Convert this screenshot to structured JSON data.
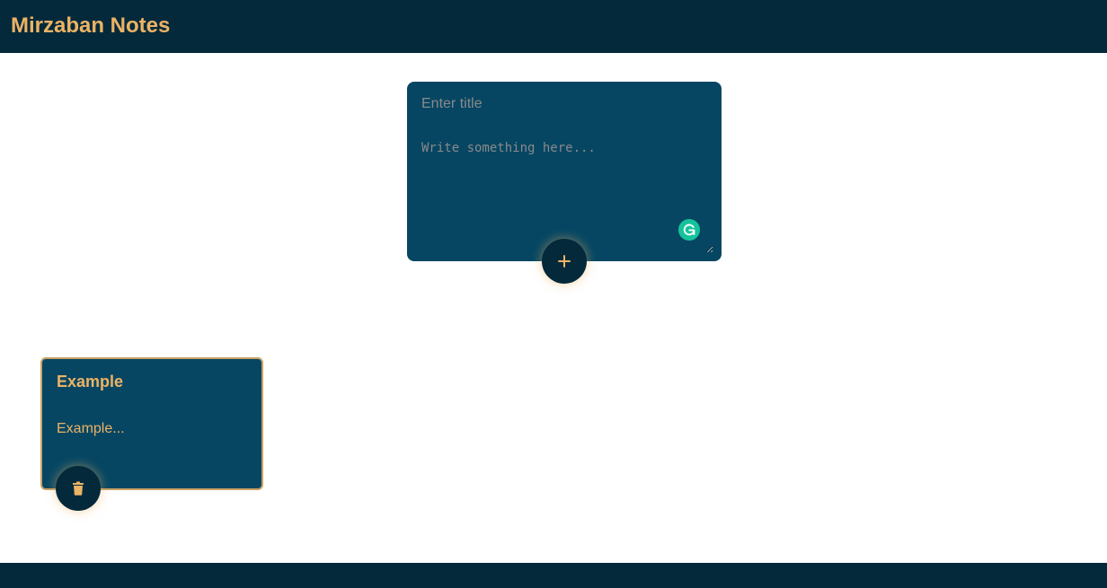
{
  "header": {
    "title": "Mirzaban Notes"
  },
  "composer": {
    "title_placeholder": "Enter title",
    "title_value": "",
    "body_placeholder": "Write something here...",
    "body_value": "",
    "grammarly_icon": "grammarly-icon",
    "add_icon": "plus-icon"
  },
  "notes": [
    {
      "title": "Example",
      "body": "Example...",
      "delete_icon": "trash-icon"
    }
  ],
  "colors": {
    "navy": "#04293a",
    "card": "#064663",
    "accent": "#ecb365",
    "grammarly": "#15c39a"
  }
}
